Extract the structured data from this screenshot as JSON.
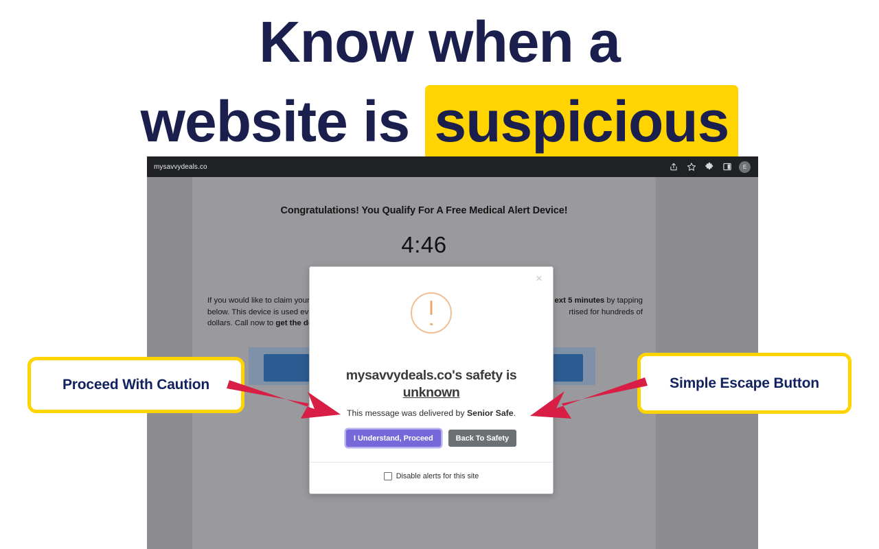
{
  "headline": {
    "line1": "Know when a",
    "line2_prefix": "website is",
    "line2_highlight": "suspicious",
    "text_color": "#1a1f4e",
    "highlight_color": "#ffd400"
  },
  "browser": {
    "url": "mysavvydeals.co",
    "bar_color": "#202124",
    "icons": [
      {
        "name": "share-icon",
        "label": "Share"
      },
      {
        "name": "bookmark-star-icon",
        "label": "Bookmark"
      },
      {
        "name": "extensions-puzzle-icon",
        "label": "Extensions"
      },
      {
        "name": "sidebar-toggle-icon",
        "label": "Sidebar"
      }
    ],
    "profile_initial": "E"
  },
  "page": {
    "headline": "Congratulations! You Qualify For A Free Medical Alert Device!",
    "timer": "4:46",
    "body_part1": "If you would like to claim your ",
    "body_part2_bold": "ext 5 minutes",
    "body_part3": " by tapping below. This device is used eve",
    "body_part4": "rtised for hundreds of dollars. Call now to ",
    "body_part5_bold": "get the de",
    "body_line1_left": "If you would like to claim your",
    "body_line1_right_bold": "ext 5 minutes",
    "body_line1_right": " by tapping",
    "body_line2_left": "below. This device is used eve",
    "body_line2_right": "rtised for hundreds of",
    "body_line3_left": "dollars. Call now to ",
    "body_line3_left_bold": "get the de",
    "cta_color": "#2b5c91"
  },
  "modal": {
    "close_label": "×",
    "icon_name": "warning-exclamation-circle-icon",
    "icon_color": "#ecaa6a",
    "title_prefix": "mysavvydeals.co's safety is",
    "title_verdict": "unknown",
    "subtitle_prefix": "This message was delivered by ",
    "subtitle_brand": "Senior Safe",
    "subtitle_suffix": ".",
    "proceed_button": "I Understand, Proceed",
    "proceed_color": "#7668d8",
    "safety_button": "Back To Safety",
    "safety_color": "#6b7075",
    "checkbox_label": "Disable alerts for this site",
    "checkbox_checked": false
  },
  "annotations": {
    "left_callout": "Proceed With Caution",
    "right_callout": "Simple Escape Button",
    "arrow_color": "#d81e45",
    "border_color": "#ffd400"
  }
}
